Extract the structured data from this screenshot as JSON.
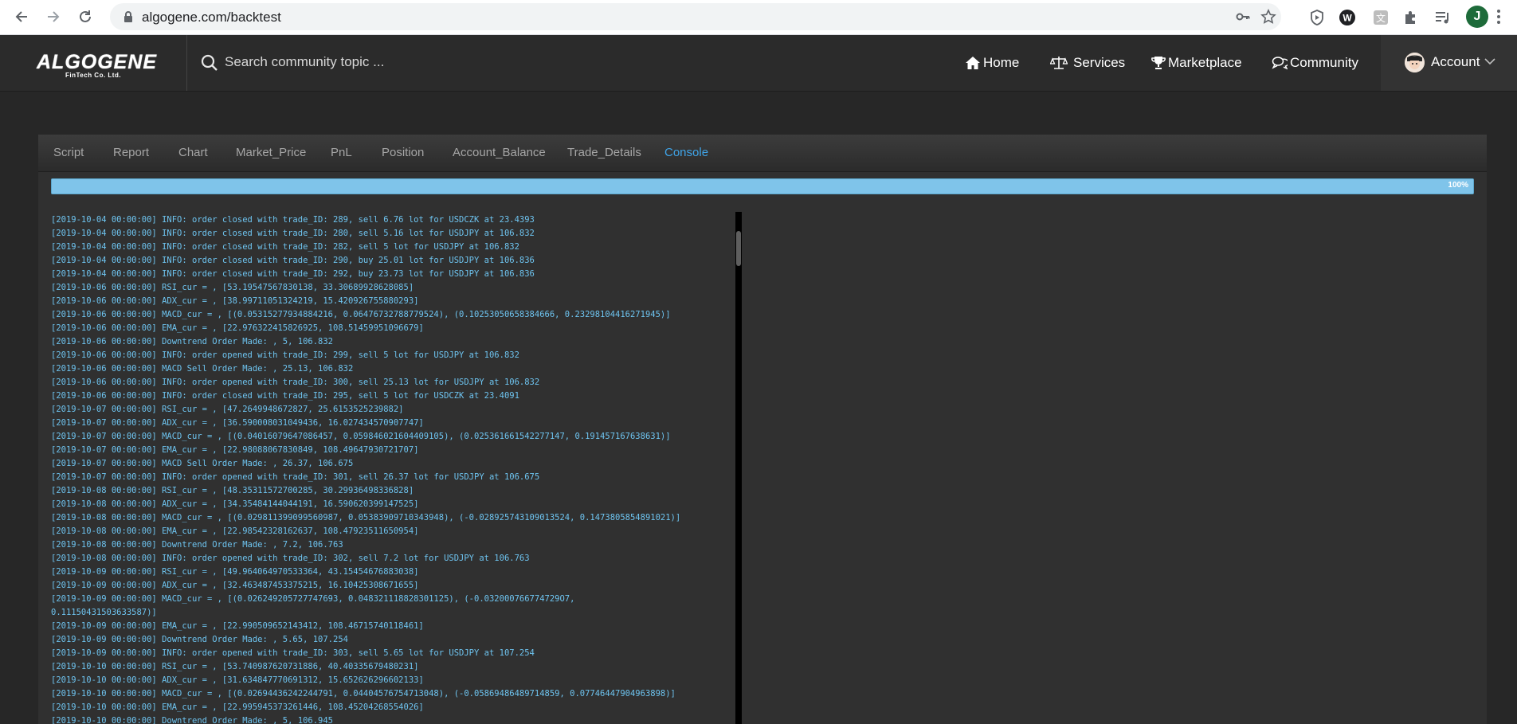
{
  "browser": {
    "url": "algogene.com/backtest",
    "profile_initial": "J"
  },
  "header": {
    "logo_text": "ALGOGENE",
    "logo_sub": "FinTech Co. Ltd.",
    "search_placeholder": "Search community topic ...",
    "nav": {
      "home": "Home",
      "services": "Services",
      "marketplace": "Marketplace",
      "community": "Community",
      "account": "Account"
    }
  },
  "tabs": [
    {
      "label": "Script",
      "active": false
    },
    {
      "label": "Report",
      "active": false
    },
    {
      "label": "Chart",
      "active": false
    },
    {
      "label": "Market_Price",
      "active": false
    },
    {
      "label": "PnL",
      "active": false
    },
    {
      "label": "Position",
      "active": false
    },
    {
      "label": "Account_Balance",
      "active": false
    },
    {
      "label": "Trade_Details",
      "active": false
    },
    {
      "label": "Console",
      "active": true
    }
  ],
  "progress": {
    "value": 1.0,
    "label": "100%"
  },
  "console_lines": [
    "[2019-10-04 00:00:00] INFO: order closed with trade_ID: 289, sell 6.76 lot for USDCZK at 23.4393",
    "[2019-10-04 00:00:00] INFO: order closed with trade_ID: 280, sell 5.16 lot for USDJPY at 106.832",
    "[2019-10-04 00:00:00] INFO: order closed with trade_ID: 282, sell 5 lot for USDJPY at 106.832",
    "[2019-10-04 00:00:00] INFO: order closed with trade_ID: 290, buy 25.01 lot for USDJPY at 106.836",
    "[2019-10-04 00:00:00] INFO: order closed with trade_ID: 292, buy 23.73 lot for USDJPY at 106.836",
    "[2019-10-06 00:00:00] RSI_cur = , [53.19547567830138, 33.30689928628085]",
    "[2019-10-06 00:00:00] ADX_cur = , [38.99711051324219, 15.420926755880293]",
    "[2019-10-06 00:00:00] MACD_cur = , [(0.05315277934884216, 0.06476732788779524), (0.10253050658384666, 0.23298104416271945)]",
    "[2019-10-06 00:00:00] EMA_cur = , [22.976322415826925, 108.51459951096679]",
    "[2019-10-06 00:00:00] Downtrend Order Made: , 5, 106.832",
    "[2019-10-06 00:00:00] INFO: order opened with trade_ID: 299, sell 5 lot for USDJPY at 106.832",
    "[2019-10-06 00:00:00] MACD Sell Order Made: , 25.13, 106.832",
    "[2019-10-06 00:00:00] INFO: order opened with trade_ID: 300, sell 25.13 lot for USDJPY at 106.832",
    "[2019-10-06 00:00:00] INFO: order closed with trade_ID: 295, sell 5 lot for USDCZK at 23.4091",
    "[2019-10-07 00:00:00] RSI_cur = , [47.2649948672827, 25.6153525239882]",
    "[2019-10-07 00:00:00] ADX_cur = , [36.590008031049436, 16.027434570907747]",
    "[2019-10-07 00:00:00] MACD_cur = , [(0.04016079647086457, 0.059846021604409105), (0.025361661542277147, 0.191457167638631)]",
    "[2019-10-07 00:00:00] EMA_cur = , [22.98088067830849, 108.49647930721707]",
    "[2019-10-07 00:00:00] MACD Sell Order Made: , 26.37, 106.675",
    "[2019-10-07 00:00:00] INFO: order opened with trade_ID: 301, sell 26.37 lot for USDJPY at 106.675",
    "[2019-10-08 00:00:00] RSI_cur = , [48.35311572700285, 30.29936498336828]",
    "[2019-10-08 00:00:00] ADX_cur = , [34.35484144044191, 16.590620399147525]",
    "[2019-10-08 00:00:00] MACD_cur = , [(0.029811399099560987, 0.05383909710343948), (-0.028925743109013524, 0.1473805854891021)]",
    "[2019-10-08 00:00:00] EMA_cur = , [22.98542328162637, 108.47923511650954]",
    "[2019-10-08 00:00:00] Downtrend Order Made: , 7.2, 106.763",
    "[2019-10-08 00:00:00] INFO: order opened with trade_ID: 302, sell 7.2 lot for USDJPY at 106.763",
    "[2019-10-09 00:00:00] RSI_cur = , [49.964064970533364, 43.15454676883038]",
    "[2019-10-09 00:00:00] ADX_cur = , [32.463487453375215, 16.10425308671655]",
    "[2019-10-09 00:00:00] MACD_cur = , [(0.026249205727747693, 0.048321118828301125), (-0.032000766774729O7,",
    "0.11150431503633587)]",
    "[2019-10-09 00:00:00] EMA_cur = , [22.990509652143412, 108.46715740118461]",
    "[2019-10-09 00:00:00] Downtrend Order Made: , 5.65, 107.254",
    "[2019-10-09 00:00:00] INFO: order opened with trade_ID: 303, sell 5.65 lot for USDJPY at 107.254",
    "[2019-10-10 00:00:00] RSI_cur = , [53.740987620731886, 40.40335679480231]",
    "[2019-10-10 00:00:00] ADX_cur = , [31.634847770691312, 15.652626296602133]",
    "[2019-10-10 00:00:00] MACD_cur = , [(0.02694436242244791, 0.04404576754713048), (-0.05869486489714859, 0.07746447904963898)]",
    "[2019-10-10 00:00:00] EMA_cur = , [22.995945373261446, 108.45204268554026]",
    "[2019-10-10 00:00:00] Downtrend Order Made: , 5, 106.945"
  ]
}
